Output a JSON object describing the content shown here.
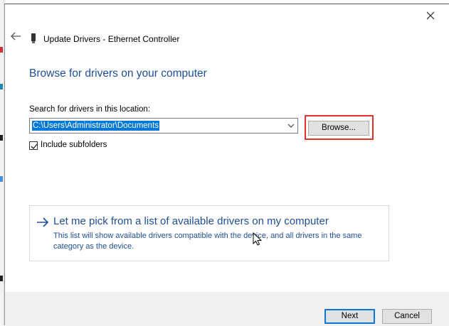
{
  "dialog": {
    "nav_title": "Update Drivers - Ethernet Controller",
    "heading": "Browse for drivers on your computer",
    "search_label": "Search for drivers in this location:",
    "path_value": "C:\\Users\\Administrator\\Documents",
    "browse_label": "Browse...",
    "include_subfolders_label": "Include subfolders",
    "include_subfolders_checked": true,
    "pick_title": "Let me pick from a list of available drivers on my computer",
    "pick_description": "This list will show available drivers compatible with the device, and all drivers in the same category as the device.",
    "next_label": "Next",
    "cancel_label": "Cancel"
  },
  "icons": {
    "close": "close-icon",
    "back": "back-arrow-icon",
    "device": "network-device-icon",
    "dropdown": "chevron-down-icon",
    "checkmark": "checkmark-icon",
    "pick_arrow": "right-arrow-icon",
    "cursor": "mouse-pointer-icon"
  },
  "colors": {
    "heading_blue": "#1f4e99",
    "selection_blue": "#0078d7",
    "highlight_red": "#e0322c"
  }
}
